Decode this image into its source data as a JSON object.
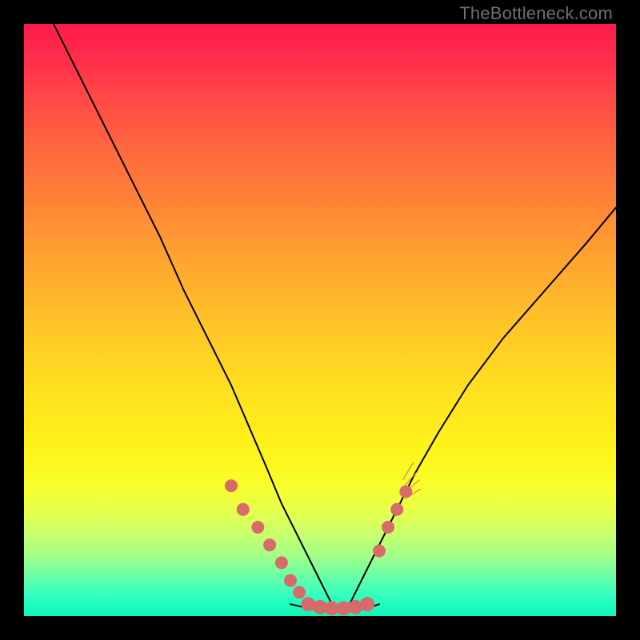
{
  "watermark": "TheBottleneck.com",
  "chart_data": {
    "type": "line",
    "title": "",
    "xlabel": "",
    "ylabel": "",
    "xlim": [
      0,
      100
    ],
    "ylim": [
      0,
      100
    ],
    "grid": false,
    "legend": false,
    "series": [
      {
        "name": "left-curve",
        "color": "#000000",
        "x": [
          5,
          12,
          18,
          23,
          27,
          31,
          35,
          38,
          41,
          43.5,
          46,
          48.5,
          50.5,
          52
        ],
        "values": [
          100,
          86,
          74,
          64,
          55,
          47,
          39,
          32,
          25,
          19,
          14,
          9,
          5,
          2
        ]
      },
      {
        "name": "right-curve",
        "color": "#000000",
        "x": [
          55,
          56.5,
          58.5,
          60.5,
          63,
          66,
          70,
          75,
          81,
          88,
          95,
          100
        ],
        "values": [
          2,
          5,
          9,
          13,
          18,
          24,
          31,
          39,
          47,
          55,
          63,
          69
        ]
      },
      {
        "name": "bottom-plateau",
        "color": "#000000",
        "x": [
          45,
          48,
          50,
          52,
          54,
          56,
          58,
          60
        ],
        "values": [
          2,
          1.3,
          1,
          1,
          1,
          1,
          1.3,
          2
        ]
      }
    ],
    "markers": [
      {
        "name": "left-side-dots",
        "color": "#d86a6a",
        "radius": 8,
        "points": [
          {
            "x": 35,
            "y": 22
          },
          {
            "x": 37,
            "y": 18
          },
          {
            "x": 39.5,
            "y": 15
          },
          {
            "x": 41.5,
            "y": 12
          },
          {
            "x": 43.5,
            "y": 9
          },
          {
            "x": 45,
            "y": 6
          },
          {
            "x": 46.5,
            "y": 4
          }
        ]
      },
      {
        "name": "bottom-dots",
        "color": "#d86a6a",
        "radius": 9,
        "points": [
          {
            "x": 48,
            "y": 2
          },
          {
            "x": 50,
            "y": 1.5
          },
          {
            "x": 52,
            "y": 1.3
          },
          {
            "x": 54,
            "y": 1.3
          },
          {
            "x": 56,
            "y": 1.5
          },
          {
            "x": 58,
            "y": 2
          }
        ]
      },
      {
        "name": "right-side-dots",
        "color": "#d86a6a",
        "radius": 8,
        "points": [
          {
            "x": 60,
            "y": 11
          },
          {
            "x": 61.5,
            "y": 15
          },
          {
            "x": 63,
            "y": 18
          },
          {
            "x": 64.5,
            "y": 21
          }
        ]
      }
    ],
    "strokes": [
      {
        "name": "right-feather",
        "color": "#d86a6a",
        "width": 1,
        "lines": [
          [
            [
              64.5,
              21
            ],
            [
              66.8,
              23
            ]
          ],
          [
            [
              64.7,
              20
            ],
            [
              67.0,
              21.5
            ]
          ],
          [
            [
              64.3,
              22
            ],
            [
              66.5,
              24.5
            ]
          ],
          [
            [
              64.0,
              23
            ],
            [
              65.8,
              26
            ]
          ]
        ]
      }
    ]
  }
}
